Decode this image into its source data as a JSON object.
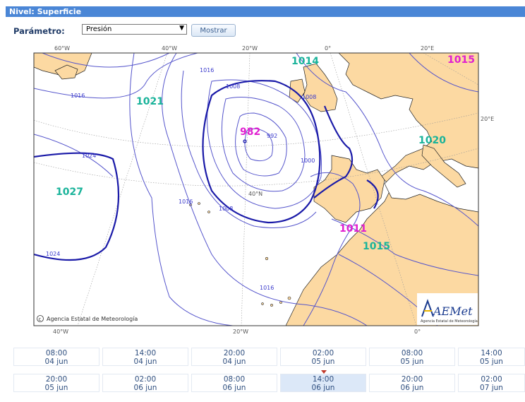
{
  "header": {
    "title": "Nivel: Superficie"
  },
  "form": {
    "param_label": "Parámetro:",
    "param_value": "Presión",
    "submit_label": "Mostrar"
  },
  "map": {
    "top_lon_labels": [
      "60°W",
      "40°W",
      "20°W",
      "0°",
      "20°E"
    ],
    "bottom_lon_labels": [
      "40°W",
      "20°W",
      "0°"
    ],
    "lat_labels": [
      "20°E",
      "40°N"
    ],
    "isobar_labels": [
      "1016",
      "1016",
      "1008",
      "1008",
      "1024",
      "992",
      "1000",
      "1016",
      "1008",
      "1024",
      "1016"
    ],
    "pressure_centers": [
      {
        "label": "1014",
        "kind": "high"
      },
      {
        "label": "1015",
        "kind": "low"
      },
      {
        "label": "1021",
        "kind": "high"
      },
      {
        "label": "982",
        "kind": "low"
      },
      {
        "label": "1020",
        "kind": "high"
      },
      {
        "label": "1027",
        "kind": "high"
      },
      {
        "label": "1011",
        "kind": "low"
      },
      {
        "label": "1015",
        "kind": "high"
      }
    ],
    "high_color": "#1ab39a",
    "low_color": "#e020d0",
    "land_color": "#fcd9a2",
    "credit": "Agencia Estatal de Meteorología",
    "logo_text": "AEMet",
    "logo_sub": "Agencia Estatal de Meteorología"
  },
  "timeline": {
    "row1": [
      {
        "time": "08:00",
        "date": "04 jun"
      },
      {
        "time": "14:00",
        "date": "04 jun"
      },
      {
        "time": "20:00",
        "date": "04 jun"
      },
      {
        "time": "02:00",
        "date": "05 jun"
      },
      {
        "time": "08:00",
        "date": "05 jun"
      },
      {
        "time": "14:00",
        "date": "05 jun"
      }
    ],
    "row2": [
      {
        "time": "20:00",
        "date": "05 jun"
      },
      {
        "time": "02:00",
        "date": "06 jun"
      },
      {
        "time": "08:00",
        "date": "06 jun"
      },
      {
        "time": "14:00",
        "date": "06 jun",
        "selected": true
      },
      {
        "time": "20:00",
        "date": "06 jun"
      },
      {
        "time": "02:00",
        "date": "07 jun"
      }
    ]
  }
}
